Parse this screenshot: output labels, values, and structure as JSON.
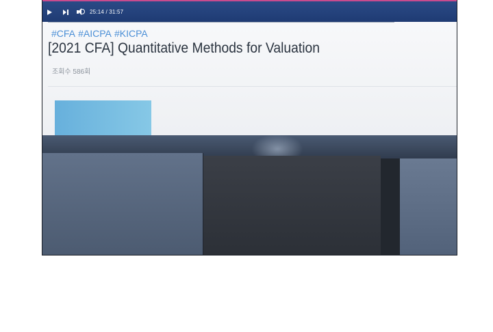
{
  "player": {
    "time_display": "25:14 / 31:57"
  },
  "video": {
    "hashtags": "#CFA  #AICPA #KICPA",
    "title": "[2021 CFA]  Quantitative Methods for Valuation",
    "views": "조회수  586회"
  },
  "colors": {
    "player_bar": "#2a4a86",
    "hashtag": "#4b8fd6",
    "thumbnail": "#67b0dc"
  },
  "icons": [
    "play-icon",
    "next-icon",
    "volume-icon"
  ]
}
